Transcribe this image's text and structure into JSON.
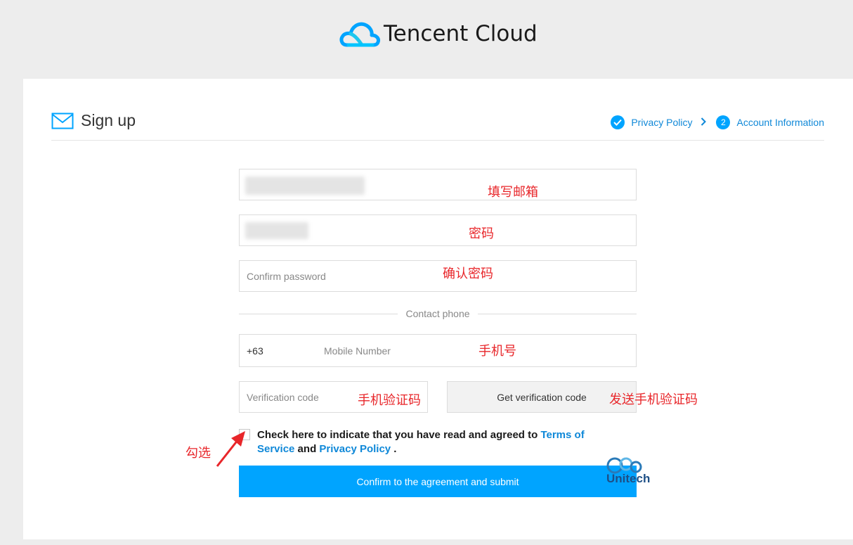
{
  "brand": {
    "name": "Tencent Cloud"
  },
  "page": {
    "title": "Sign up"
  },
  "steps": [
    {
      "label": "Privacy Policy",
      "state": "done"
    },
    {
      "number": "2",
      "label": "Account Information",
      "state": "current"
    }
  ],
  "form": {
    "email": {
      "value": "",
      "placeholder": ""
    },
    "password": {
      "value": "",
      "placeholder": ""
    },
    "confirm_password": {
      "placeholder": "Confirm password"
    },
    "contact_phone_label": "Contact phone",
    "phone_code": "+63",
    "mobile": {
      "placeholder": "Mobile Number"
    },
    "verification": {
      "placeholder": "Verification code"
    },
    "get_code_label": "Get verification code",
    "agreement": {
      "prefix": "Check here to indicate that you have read and agreed to ",
      "terms_link": "Terms of Service",
      "and": " and ",
      "privacy_link": "Privacy Policy",
      "suffix": " ."
    },
    "submit_label": "Confirm to the agreement and submit"
  },
  "annotations": {
    "email": "填写邮箱",
    "password": "密码",
    "confirm": "确认密码",
    "mobile": "手机号",
    "verify": "手机验证码",
    "send_code": "发送手机验证码",
    "check": "勾选"
  },
  "watermark": {
    "text": "Unitech"
  },
  "colors": {
    "accent": "#00a4ff",
    "link": "#0f88d8",
    "annotation": "#e8262a",
    "background": "#ededed"
  }
}
